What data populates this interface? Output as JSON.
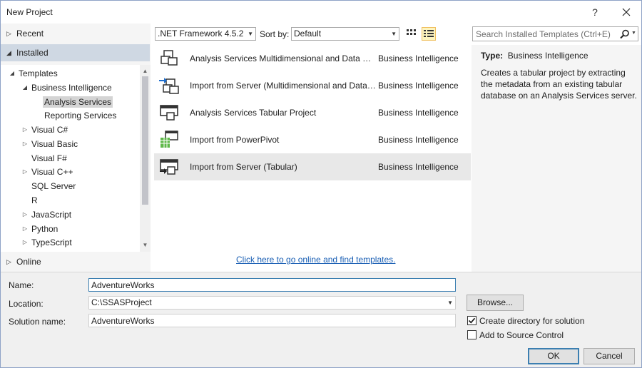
{
  "window": {
    "title": "New Project",
    "help_label": "?"
  },
  "nav": {
    "recent": "Recent",
    "installed": "Installed",
    "online": "Online",
    "tree": [
      {
        "label": "Templates",
        "expanded": true
      },
      {
        "label": "Business Intelligence",
        "expanded": true
      },
      {
        "label": "Analysis Services",
        "selected": true
      },
      {
        "label": "Reporting Services"
      },
      {
        "label": "Visual C#",
        "expanded": false
      },
      {
        "label": "Visual Basic",
        "expanded": false
      },
      {
        "label": "Visual F#"
      },
      {
        "label": "Visual C++",
        "expanded": false
      },
      {
        "label": "SQL Server"
      },
      {
        "label": "R"
      },
      {
        "label": "JavaScript",
        "expanded": false
      },
      {
        "label": "Python",
        "expanded": false
      },
      {
        "label": "TypeScript",
        "expanded": false
      }
    ]
  },
  "toolbar": {
    "framework": ".NET Framework 4.5.2",
    "sort_by_label": "Sort by:",
    "sort_value": "Default",
    "search_placeholder": "Search Installed Templates (Ctrl+E)"
  },
  "templates": [
    {
      "name": "Analysis Services Multidimensional and Data Minin...",
      "type": "Business Intelligence",
      "icon": "multidimensional-project-icon"
    },
    {
      "name": "Import from Server (Multidimensional and Data Mi...",
      "type": "Business Intelligence",
      "icon": "import-multidimensional-icon"
    },
    {
      "name": "Analysis Services Tabular Project",
      "type": "Business Intelligence",
      "icon": "tabular-project-icon"
    },
    {
      "name": "Import from PowerPivot",
      "type": "Business Intelligence",
      "icon": "powerpivot-icon"
    },
    {
      "name": "Import from Server (Tabular)",
      "type": "Business Intelligence",
      "icon": "import-tabular-icon",
      "selected": true
    }
  ],
  "online_link": "Click here to go online and find templates.",
  "details": {
    "type_label": "Type:",
    "type_value": "Business Intelligence",
    "description": "Creates a tabular project by extracting the metadata from an existing tabular database on an Analysis Services server."
  },
  "form": {
    "name_label": "Name:",
    "name_value": "AdventureWorks",
    "location_label": "Location:",
    "location_value": "C:\\SSASProject",
    "solution_label": "Solution name:",
    "solution_value": "AdventureWorks",
    "browse_label": "Browse...",
    "create_dir_label": "Create directory for solution",
    "create_dir_checked": true,
    "source_control_label": "Add to Source Control",
    "source_control_checked": false,
    "ok_label": "OK",
    "cancel_label": "Cancel"
  },
  "colors": {
    "accent": "#3c7fb1",
    "link": "#1a5fb4",
    "selection": "#cfd8e3"
  }
}
